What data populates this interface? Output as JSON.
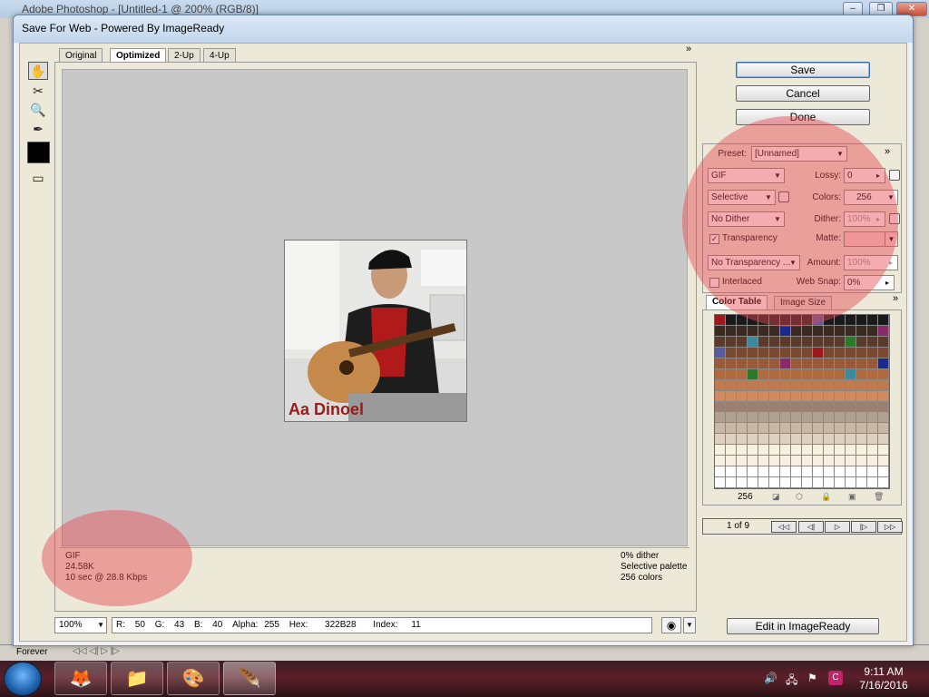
{
  "ps_window": {
    "title": "Adobe Photoshop - [Untitled-1 @ 200% (RGB/8)]",
    "bottom_bar": {
      "loop": "Forever"
    }
  },
  "dialog": {
    "title": "Save For Web - Powered By ImageReady",
    "tabs": [
      "Original",
      "Optimized",
      "2-Up",
      "4-Up"
    ],
    "active_tab": "Optimized",
    "image_caption": "Aa Dinoel",
    "info_left": {
      "format": "GIF",
      "size": "24.58K",
      "speed": "10 sec @ 28.8 Kbps"
    },
    "info_right": {
      "dither": "0% dither",
      "palette": "Selective palette",
      "colors": "256 colors"
    },
    "buttons": {
      "save": "Save",
      "cancel": "Cancel",
      "done": "Done",
      "edit_in_imageready": "Edit in ImageReady"
    },
    "settings": {
      "preset_label": "Preset:",
      "preset_value": "[Unnamed]",
      "format": "GIF",
      "lossy_label": "Lossy:",
      "lossy_value": "0",
      "reduction": "Selective",
      "colors_label": "Colors:",
      "colors_value": "256",
      "dither_method": "No Dither",
      "dither_label": "Dither:",
      "dither_value": "100%",
      "transparency_label": "Transparency",
      "transparency_checked": true,
      "matte_label": "Matte:",
      "transparency_dither": "No Transparency ...",
      "amount_label": "Amount:",
      "amount_value": "100%",
      "interlaced_label": "Interlaced",
      "interlaced_checked": false,
      "websnap_label": "Web Snap:",
      "websnap_value": "0%"
    },
    "color_table": {
      "tabs": [
        "Color Table",
        "Image Size"
      ],
      "count": "256"
    },
    "animation": {
      "frame": "1 of 9"
    },
    "status": {
      "zoom": "100%",
      "r_label": "R:",
      "r": "50",
      "g_label": "G:",
      "g": "43",
      "b_label": "B:",
      "b": "40",
      "alpha_label": "Alpha:",
      "alpha": "255",
      "hex_label": "Hex:",
      "hex": "322B28",
      "index_label": "Index:",
      "index": "11"
    }
  },
  "taskbar": {
    "time": "9:11 AM",
    "date": "7/16/2016"
  },
  "colors": {
    "highlight": "#e64650",
    "dialog_bg": "#ece9d8",
    "canvas_bg": "#c8c8c8"
  }
}
